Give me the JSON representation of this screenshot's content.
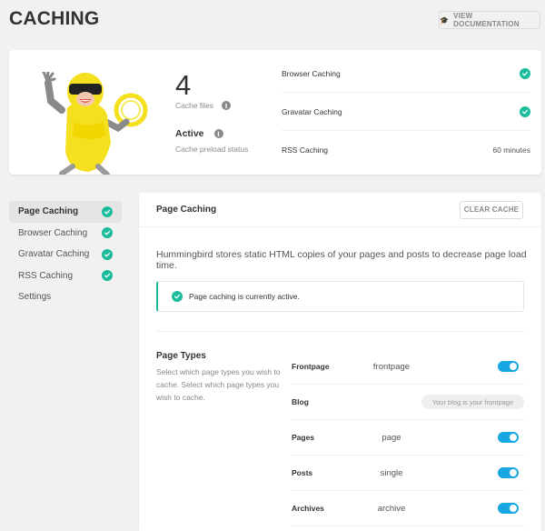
{
  "header": {
    "title": "CACHING",
    "doc_button": "VIEW DOCUMENTATION"
  },
  "summary": {
    "cache_files_count": "4",
    "cache_files_label": "Cache files",
    "preload_status": "Active",
    "preload_label": "Cache preload status",
    "rows": [
      {
        "label": "Browser Caching",
        "status": "check"
      },
      {
        "label": "Gravatar Caching",
        "status": "check"
      },
      {
        "label": "RSS Caching",
        "value": "60 minutes"
      }
    ]
  },
  "sidebar": {
    "items": [
      {
        "label": "Page Caching",
        "active": true,
        "check": true
      },
      {
        "label": "Browser Caching",
        "check": true
      },
      {
        "label": "Gravatar Caching",
        "check": true
      },
      {
        "label": "RSS Caching",
        "check": true
      },
      {
        "label": "Settings",
        "check": false
      }
    ]
  },
  "main": {
    "title": "Page Caching",
    "clear_button": "CLEAR CACHE",
    "description": "Hummingbird stores static HTML copies of your pages and posts to decrease page load time.",
    "notice": "Page caching is currently active.",
    "page_types": {
      "title": "Page Types",
      "description": "Select which page types you wish to cache. Select which page types you wish to cache.",
      "rows": [
        {
          "name": "Frontpage",
          "value": "frontpage",
          "enabled": true
        },
        {
          "name": "Blog",
          "note": "Your blog is your frontpage"
        },
        {
          "name": "Pages",
          "value": "page",
          "enabled": true
        },
        {
          "name": "Posts",
          "value": "single",
          "enabled": true
        },
        {
          "name": "Archives",
          "value": "archive",
          "enabled": true
        }
      ]
    }
  },
  "colors": {
    "accent_green": "#1abc9c",
    "toggle_blue": "#17a8e3"
  }
}
